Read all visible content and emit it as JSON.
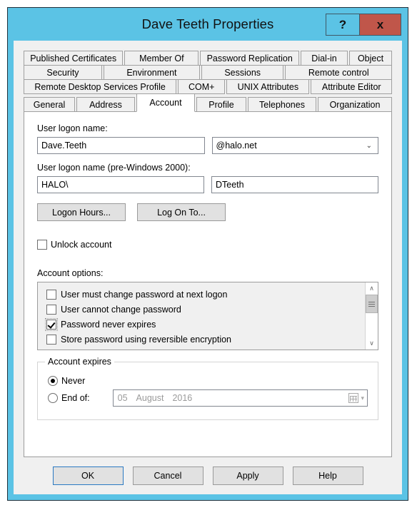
{
  "window": {
    "title": "Dave Teeth Properties",
    "help_button": "?",
    "close_button": "x"
  },
  "tabs": {
    "row1": [
      {
        "label": "Published Certificates",
        "selected": false
      },
      {
        "label": "Member Of",
        "selected": false
      },
      {
        "label": "Password Replication",
        "selected": false
      },
      {
        "label": "Dial-in",
        "selected": false
      },
      {
        "label": "Object",
        "selected": false
      }
    ],
    "row2": [
      {
        "label": "Security",
        "selected": false
      },
      {
        "label": "Environment",
        "selected": false
      },
      {
        "label": "Sessions",
        "selected": false
      },
      {
        "label": "Remote control",
        "selected": false
      }
    ],
    "row3": [
      {
        "label": "Remote Desktop Services Profile",
        "selected": false
      },
      {
        "label": "COM+",
        "selected": false
      },
      {
        "label": "UNIX Attributes",
        "selected": false
      },
      {
        "label": "Attribute Editor",
        "selected": false
      }
    ],
    "row4": [
      {
        "label": "General",
        "selected": false
      },
      {
        "label": "Address",
        "selected": false
      },
      {
        "label": "Account",
        "selected": true
      },
      {
        "label": "Profile",
        "selected": false
      },
      {
        "label": "Telephones",
        "selected": false
      },
      {
        "label": "Organization",
        "selected": false
      }
    ]
  },
  "account_tab": {
    "logon_name_label": "User logon name:",
    "logon_name_value": "Dave.Teeth",
    "upn_suffix_value": "@halo.net",
    "upn_suffix_caret": "⌄",
    "pre2000_label": "User logon name (pre-Windows 2000):",
    "pre2000_domain_value": "HALO\\",
    "pre2000_name_value": "DTeeth",
    "logon_hours_button": "Logon Hours...",
    "log_on_to_button": "Log On To...",
    "unlock_account_label": "Unlock account",
    "unlock_account_checked": false,
    "account_options_label": "Account options:",
    "account_options": [
      {
        "label": "User must change password at next logon",
        "checked": false
      },
      {
        "label": "User cannot change password",
        "checked": false
      },
      {
        "label": "Password never expires",
        "checked": true
      },
      {
        "label": "Store password using reversible encryption",
        "checked": false
      }
    ],
    "scroll_up_arrow": "∧",
    "scroll_down_arrow": "∨",
    "account_expires": {
      "title": "Account expires",
      "never_label": "Never",
      "never_selected": true,
      "end_of_label": "End of:",
      "end_of_selected": false,
      "date_day": "05",
      "date_month": "August",
      "date_year": "2016",
      "date_caret": "▾"
    }
  },
  "dialog_buttons": {
    "ok": "OK",
    "cancel": "Cancel",
    "apply": "Apply",
    "help": "Help"
  }
}
